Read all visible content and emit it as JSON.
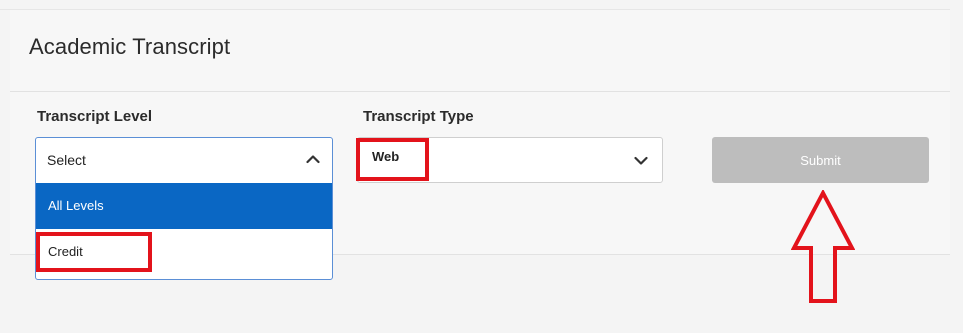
{
  "page": {
    "title": "Academic Transcript"
  },
  "form": {
    "transcript_level": {
      "label": "Transcript Level",
      "current_text": "Select",
      "options": [
        {
          "label": "All Levels",
          "highlighted": true
        },
        {
          "label": "Credit",
          "highlighted": false
        }
      ]
    },
    "transcript_type": {
      "label": "Transcript Type",
      "value": "Web"
    },
    "submit": {
      "label": "Submit",
      "enabled": false
    }
  },
  "colors": {
    "highlight": "#0a67c4",
    "annotation": "#e3131b",
    "disabled_button": "#bdbdbd",
    "focus_border": "#5b8fd6"
  },
  "icons": {
    "level_caret": "chevron-up-icon",
    "type_caret": "chevron-down-icon",
    "annotation_arrow": "up-arrow-icon"
  }
}
